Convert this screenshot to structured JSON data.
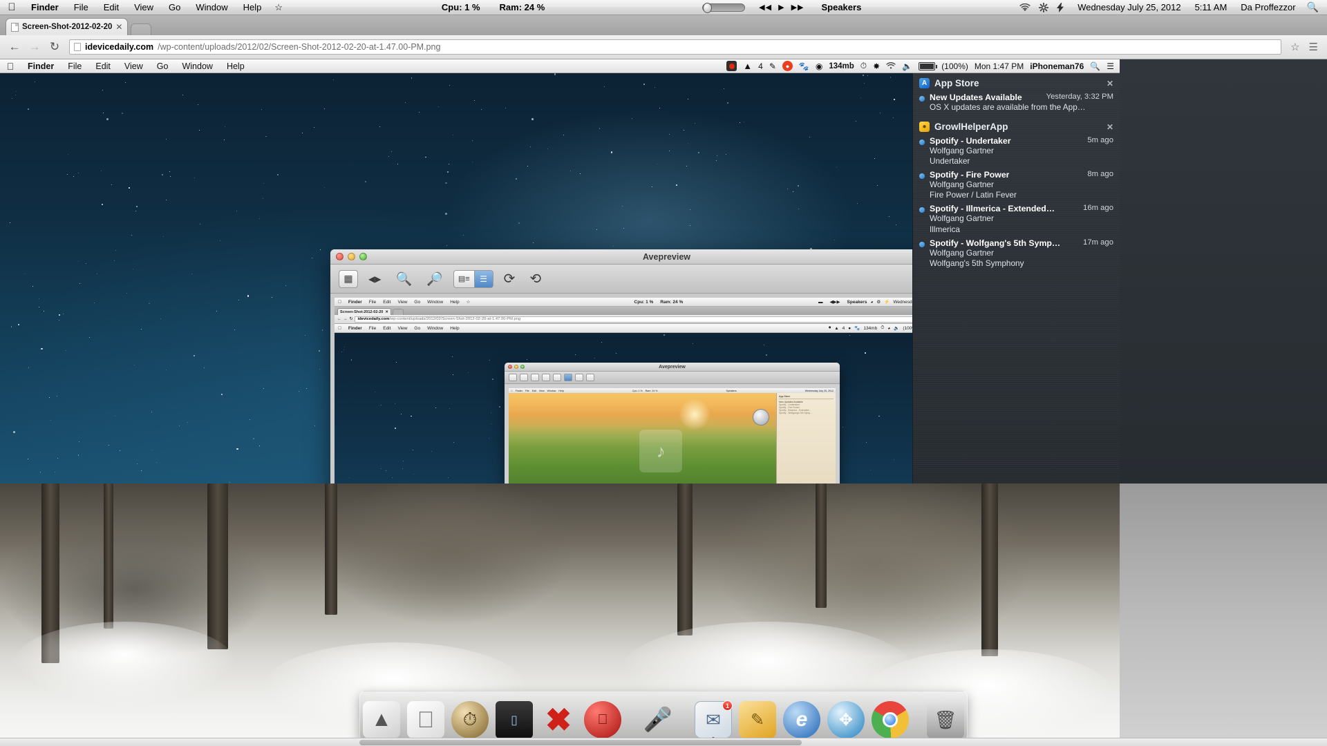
{
  "outer_menubar": {
    "apple_icon": "apple-icon",
    "items": [
      "Finder",
      "File",
      "Edit",
      "View",
      "Go",
      "Window",
      "Help"
    ],
    "active_app": "Finder",
    "star_icon": "star-outline-icon",
    "cpu": "Cpu: 1 %",
    "ram": "Ram: 24 %",
    "transport": [
      "◀◀",
      "▶",
      "▶▶"
    ],
    "audio_device": "Speakers",
    "icons": [
      "wifi-icon",
      "gear-icon",
      "bolt-icon"
    ],
    "date": "Wednesday July 25, 2012",
    "time": "5:11 AM",
    "user": "Da Proffezzor",
    "search_icon": "search-icon"
  },
  "browser": {
    "tab": {
      "title": "Screen-Shot-2012-02-20",
      "favicon": "document-icon",
      "close_icon": "close-icon"
    },
    "new_tab_icon": "new-tab-button",
    "back_icon": "back-arrow-icon",
    "forward_icon": "forward-arrow-icon",
    "reload_icon": "reload-icon",
    "omnibox": {
      "favicon": "page-icon",
      "domain": "idevicedaily.com",
      "path": "/wp-content/uploads/2012/02/Screen-Shot-2012-02-20-at-1.47.00-PM.png"
    },
    "bookmark_icon": "star-icon",
    "menu_icon": "wrench-icon"
  },
  "inner_menubar": {
    "apple_icon": "apple-icon",
    "items": [
      "Finder",
      "File",
      "Edit",
      "View",
      "Go",
      "Window",
      "Help"
    ],
    "active_app": "Finder",
    "status": {
      "record_icon": "record-icon",
      "adobe_icon": "adobe-icon",
      "adobe_count": "4",
      "clip_icon": "clipboard-icon",
      "drop_icon": "drop-icon",
      "paw_icon": "paw-icon",
      "memory_icon": "memory-icon",
      "memory": "134mb",
      "timemachine_icon": "time-machine-icon",
      "bluetooth_icon": "bluetooth-icon",
      "wifi_icon": "wifi-icon",
      "volume_icon": "volume-icon",
      "battery_icon": "battery-icon",
      "battery": "(100%)",
      "clock": "Mon 1:47 PM",
      "user": "iPhoneman76",
      "search_icon": "search-icon",
      "notification_icon": "notification-center-icon"
    }
  },
  "notification_center": {
    "groups": [
      {
        "app": "App Store",
        "app_icon": "appstore-icon",
        "close_icon": "close-icon",
        "items": [
          {
            "title": "New Updates Available",
            "time": "Yesterday, 3:32 PM",
            "line2": "OS X updates are available from the App…",
            "line3": ""
          }
        ]
      },
      {
        "app": "GrowlHelperApp",
        "app_icon": "growl-icon",
        "close_icon": "close-icon",
        "items": [
          {
            "title": "Spotify - Undertaker",
            "time": "5m ago",
            "line2": "Wolfgang Gartner",
            "line3": "Undertaker"
          },
          {
            "title": "Spotify - Fire Power",
            "time": "8m ago",
            "line2": "Wolfgang Gartner",
            "line3": "Fire Power / Latin Fever"
          },
          {
            "title": "Spotify - Illmerica - Extended…",
            "time": "16m ago",
            "line2": "Wolfgang Gartner",
            "line3": "Illmerica"
          },
          {
            "title": "Spotify - Wolfgang's 5th Symp…",
            "time": "17m ago",
            "line2": "Wolfgang Gartner",
            "line3": "Wolfgang's 5th Symphony"
          }
        ]
      }
    ]
  },
  "avepreview": {
    "title": "Avepreview",
    "traffic_lights": [
      "close-button",
      "minimize-button",
      "zoom-button"
    ],
    "resize_icon": "fullscreen-toggle-icon",
    "toolbar": [
      {
        "name": "sidebar-toggle-button",
        "glyph": "▤"
      },
      {
        "name": "prev-next-button",
        "glyph": "◀▶"
      },
      {
        "name": "zoom-in-button",
        "glyph": "🔍"
      },
      {
        "name": "zoom-out-button",
        "glyph": "🔍"
      },
      {
        "name": "list-view-button",
        "glyph": "☰"
      },
      {
        "name": "grid-view-button",
        "glyph": "≡"
      },
      {
        "name": "rotate-right-button",
        "glyph": "↻"
      },
      {
        "name": "rotate-left-button",
        "glyph": "↺"
      }
    ]
  },
  "avepreview_level2": {
    "title": "Avepreview"
  },
  "dock": {
    "items": [
      {
        "name": "finder-icon",
        "glyph": "🔵",
        "color": "#dcdcdc",
        "badge": "",
        "running": true
      },
      {
        "name": "apple-icon",
        "glyph": "",
        "color": "#e4e4e4",
        "badge": "",
        "running": false
      },
      {
        "name": "time-machine-icon",
        "glyph": "◴",
        "color": "#5b5b5b",
        "badge": "",
        "running": false
      },
      {
        "name": "display-icon",
        "glyph": "▭",
        "color": "#1c1c1c",
        "badge": "",
        "running": false
      },
      {
        "name": "close-x-icon",
        "glyph": "✖",
        "color": "#cf2020",
        "badge": "",
        "running": false
      },
      {
        "name": "apple-red-icon",
        "glyph": "🍎",
        "color": "#c81f1f",
        "badge": "",
        "running": false
      },
      {
        "name": "microphone-icon",
        "glyph": "🎤",
        "color": "#2f86d8",
        "badge": "",
        "running": false
      },
      {
        "name": "mail-icon",
        "glyph": "✉",
        "color": "#4e9ede",
        "badge": "1",
        "running": true
      },
      {
        "name": "notes-icon",
        "glyph": "📒",
        "color": "#e8b33a",
        "badge": "",
        "running": true
      },
      {
        "name": "internet-explorer-icon",
        "glyph": "e",
        "color": "#2a7fd4",
        "badge": "",
        "running": true
      },
      {
        "name": "safari-icon",
        "glyph": "🧭",
        "color": "#2e9bd6",
        "badge": "",
        "running": true
      },
      {
        "name": "chrome-icon",
        "glyph": "◉",
        "color": "#e8453c",
        "badge": "",
        "running": true
      },
      {
        "name": "trash-icon",
        "glyph": "🗑",
        "color": "#9a9a9a",
        "badge": "",
        "running": false
      }
    ]
  },
  "colors": {
    "accent_blue": "#4f88c8",
    "notification_bg": "#2d3238",
    "menubar_bg": "#e8e8e8",
    "badge_red": "#d8261a"
  }
}
